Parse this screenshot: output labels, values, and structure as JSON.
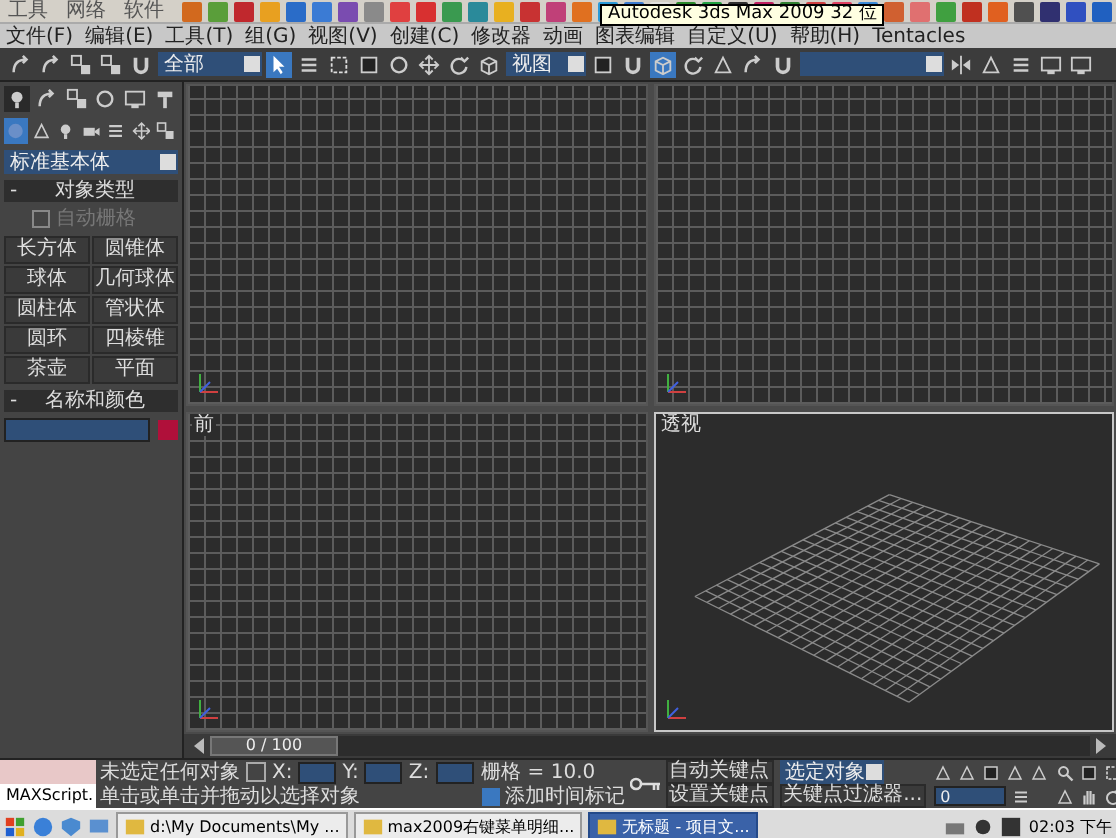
{
  "top_strip": {
    "groups": [
      "工具",
      "网络",
      "软件"
    ]
  },
  "menu": {
    "items_left": [
      "文件(F)",
      "编辑(E)",
      "工具(T)",
      "组(G)",
      "视图(V)",
      "创建(C)",
      "修改器",
      "动画",
      "图表编辑"
    ],
    "tooltip": "Autodesk 3ds Max 2009 32 位",
    "items_right": [
      "自定义(U)",
      "帮助(H)",
      "Tentacles"
    ]
  },
  "main_toolbar": {
    "tools_a": [
      {
        "selected": false
      },
      {
        "selected": false
      },
      {
        "selected": false
      },
      {
        "selected": false
      },
      {
        "selected": false
      }
    ],
    "selection_filter": "全部",
    "tools_b": [
      {
        "selected": true
      },
      {
        "selected": false
      },
      {
        "selected": false
      },
      {
        "selected": false
      },
      {
        "selected": false
      },
      {
        "selected": false
      },
      {
        "selected": false
      },
      {
        "selected": false
      }
    ],
    "reference_coord": "视图",
    "tools_c": [
      {
        "selected": false
      },
      {
        "selected": false
      },
      {
        "selected": true
      },
      {
        "selected": false
      },
      {
        "selected": false
      },
      {
        "selected": false
      },
      {
        "selected": false
      }
    ],
    "tools_d": [
      {
        "selected": false
      },
      {
        "selected": false
      },
      {
        "selected": false
      },
      {
        "selected": false
      },
      {
        "selected": false
      }
    ]
  },
  "command_panel": {
    "tabs": [
      {
        "selected": true
      },
      {
        "selected": false
      },
      {
        "selected": false
      },
      {
        "selected": false
      },
      {
        "selected": false
      },
      {
        "selected": false
      }
    ],
    "categories": [
      {
        "selected": true
      },
      {
        "selected": false
      },
      {
        "selected": false
      },
      {
        "selected": false
      },
      {
        "selected": false
      },
      {
        "selected": false
      },
      {
        "selected": false
      }
    ],
    "object_class": "标准基本体",
    "object_type": {
      "toggle": "-",
      "title": "对象类型",
      "autogrid": {
        "label": "自动栅格",
        "checked": false,
        "disabled": true
      },
      "buttons": [
        "长方体",
        "圆锥体",
        "球体",
        "几何球体",
        "圆柱体",
        "管状体",
        "圆环",
        "四棱锥",
        "茶壶",
        "平面"
      ]
    },
    "name_color": {
      "toggle": "-",
      "title": "名称和颜色"
    }
  },
  "viewports": [
    {
      "kind": "grid",
      "active": false
    },
    {
      "kind": "grid",
      "active": false
    },
    {
      "kind": "grid",
      "label": "前",
      "active": false
    },
    {
      "kind": "perspective",
      "label": "透视",
      "active": true
    }
  ],
  "time_slider": {
    "reading": "0 / 100",
    "level": 0
  },
  "status_bar": {
    "script_output": "MAXScript.",
    "selection": "未选定任何对象",
    "prompt": "单击或单击并拖动以选择对象",
    "coords": [
      "X:",
      "Y:",
      "Z:"
    ],
    "grid": "栅格 = 10.0",
    "add_time_tag": "添加时间标记",
    "auto_key": "自动关键点",
    "key_mode": "选定对象",
    "set_key": "设置关键点",
    "key_filters": "关键点过滤器...",
    "frame": "0"
  },
  "taskbar": {
    "tasks": [
      {
        "label": "d:\\My Documents\\My ...",
        "selected": false
      },
      {
        "label": "max2009右键菜单明细...",
        "selected": false
      },
      {
        "label": "无标题 - 项目文...",
        "selected": true
      }
    ],
    "clock": "02:03 下午"
  }
}
